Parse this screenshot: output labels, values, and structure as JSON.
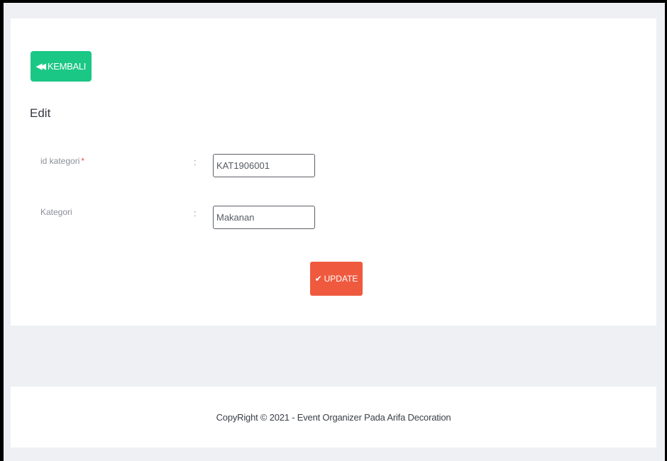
{
  "back_button": {
    "icon": "double-chevron-left-icon",
    "icon_glyph": "◀◀",
    "label": "KEMBALI",
    "color": "#1bc785"
  },
  "section": {
    "title": "Edit"
  },
  "form": {
    "fields": [
      {
        "label": "id kategori",
        "required_mark": "*",
        "colon": ":",
        "value": "KAT1906001"
      },
      {
        "label": "Kategori",
        "required_mark": "",
        "colon": ":",
        "value": "Makanan"
      }
    ]
  },
  "update_button": {
    "icon": "checkmark-icon",
    "icon_glyph": "✔",
    "label": "UPDATE",
    "color": "#ef5a3f"
  },
  "footer": {
    "text": "CopyRight © 2021 - Event Organizer Pada Arifa Decoration"
  }
}
